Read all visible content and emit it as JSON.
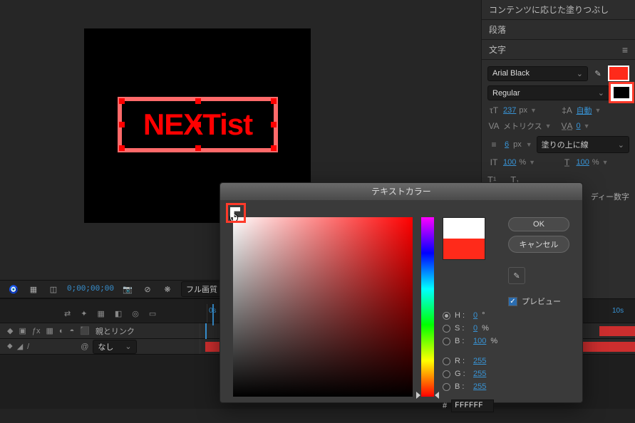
{
  "viewport": {
    "text": "NEXTist"
  },
  "panels": {
    "content_fill": "コンテンツに応じた塗りつぶし",
    "paragraph": "段落",
    "character": "文字"
  },
  "char": {
    "font": "Arial Black",
    "style": "Regular",
    "size_value": "237",
    "size_unit": "px",
    "leading": "自動",
    "metrics": "メトリクス",
    "tracking": "0",
    "stroke_width": "6",
    "stroke_width_unit": "px",
    "stroke_style": "塗りの上に線",
    "vscale": "100",
    "hscale": "100",
    "percent": "%",
    "hindi_digits": "ディー数字"
  },
  "bottom": {
    "timecode": "0;00;00;00",
    "quality": "フル画質"
  },
  "timeline": {
    "mark0": "0s",
    "mark10": "10s",
    "parent_link": "親とリンク",
    "none": "なし"
  },
  "dialog": {
    "title": "テキストカラー",
    "ok": "OK",
    "cancel": "キャンセル",
    "preview": "プレビュー",
    "H_lbl": "H :",
    "H_val": "0",
    "H_unit": "°",
    "S_lbl": "S :",
    "S_val": "0",
    "S_unit": "%",
    "B_lbl": "B :",
    "B_val": "100",
    "B_unit": "%",
    "R_lbl": "R :",
    "R_val": "255",
    "G_lbl": "G :",
    "G_val": "255",
    "Bl_lbl": "B :",
    "Bl_val": "255",
    "hex_lbl": "#",
    "hex_val": "FFFFFF"
  }
}
